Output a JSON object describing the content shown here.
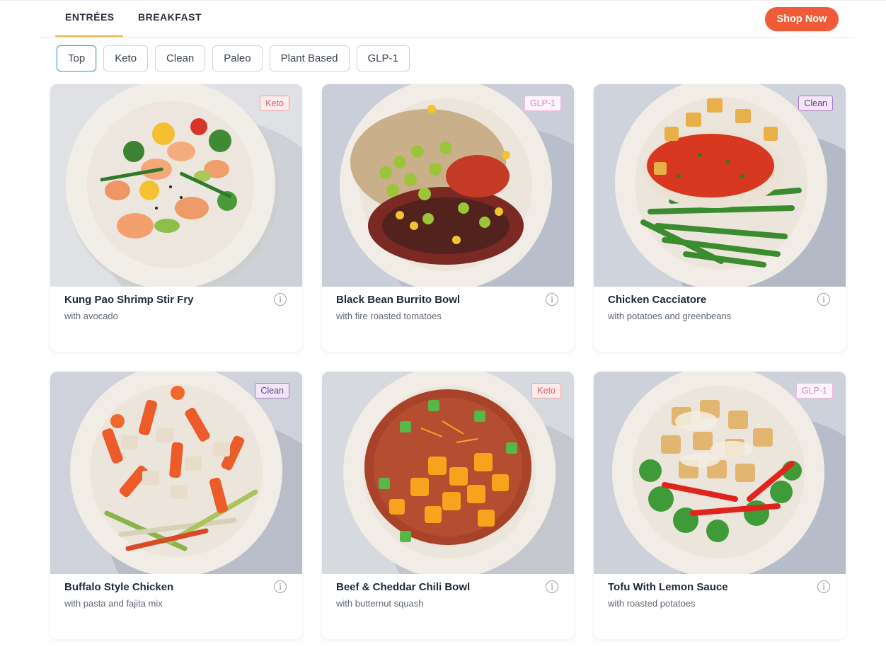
{
  "nav": {
    "tabs": [
      {
        "label": "ENTRÉES",
        "active": true
      },
      {
        "label": "BREAKFAST",
        "active": false
      }
    ],
    "cta_label": "Shop Now",
    "accent_color": "#ef5b36",
    "active_tab_underline": "#f2b04a"
  },
  "filters": {
    "chips": [
      "Top",
      "Keto",
      "Clean",
      "Paleo",
      "Plant Based",
      "GLP-1"
    ],
    "selected": "Top"
  },
  "meals": [
    {
      "title": "Kung Pao Shrimp Stir Fry",
      "subtitle": "with avocado",
      "badge": "Keto",
      "icon": "info-icon"
    },
    {
      "title": "Black Bean Burrito Bowl",
      "subtitle": "with fire roasted tomatoes",
      "badge": "GLP-1",
      "icon": "info-icon"
    },
    {
      "title": "Chicken Cacciatore",
      "subtitle": "with potatoes and greenbeans",
      "badge": "Clean",
      "icon": "info-icon"
    },
    {
      "title": "Buffalo Style Chicken",
      "subtitle": "with pasta and fajita mix",
      "badge": "Clean",
      "icon": "info-icon"
    },
    {
      "title": "Beef & Cheddar Chili Bowl",
      "subtitle": "with butternut squash",
      "badge": "Keto",
      "icon": "info-icon"
    },
    {
      "title": "Tofu With Lemon Sauce",
      "subtitle": "with roasted potatoes",
      "badge": "GLP-1",
      "icon": "info-icon"
    }
  ]
}
